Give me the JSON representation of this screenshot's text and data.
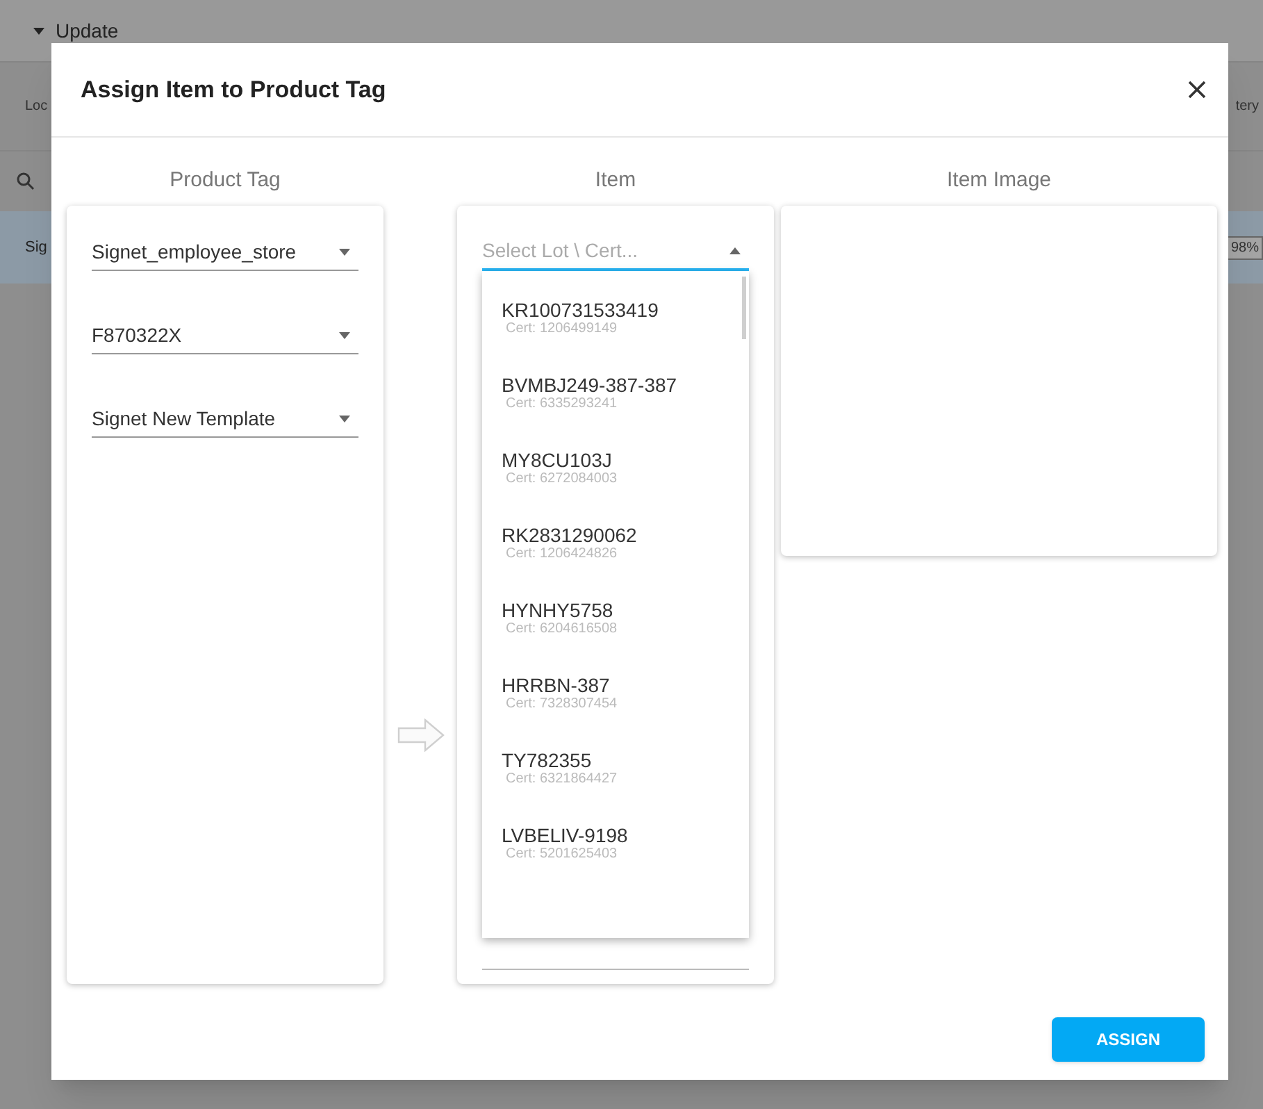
{
  "background": {
    "section": {
      "label": "Update",
      "expanded": true
    },
    "column_1": "Loc",
    "column_2": "tery",
    "row": {
      "cell_1": "Sig",
      "cell_2": "98%",
      "selected": true
    }
  },
  "dialog": {
    "title": "Assign Item to Product Tag",
    "product_tag": {
      "heading": "Product Tag",
      "selects": [
        {
          "value": "Signet_employee_store"
        },
        {
          "value": "F870322X"
        },
        {
          "value": "Signet New Template"
        }
      ]
    },
    "item": {
      "heading": "Item",
      "select": {
        "placeholder": "Select Lot \\ Cert...",
        "open": true
      },
      "options": [
        {
          "name": "KR100731533419",
          "cert": "Cert: 1206499149"
        },
        {
          "name": "BVMBJ249-387-387",
          "cert": "Cert: 6335293241"
        },
        {
          "name": "MY8CU103J",
          "cert": "Cert: 6272084003"
        },
        {
          "name": "RK2831290062",
          "cert": "Cert: 1206424826"
        },
        {
          "name": "HYNHY5758",
          "cert": "Cert: 6204616508"
        },
        {
          "name": "HRRBN-387",
          "cert": "Cert: 7328307454"
        },
        {
          "name": "TY782355",
          "cert": "Cert: 6321864427"
        },
        {
          "name": "LVBELIV-9198",
          "cert": "Cert: 5201625403"
        }
      ]
    },
    "item_image": {
      "heading": "Item Image"
    },
    "button": "ASSIGN"
  }
}
